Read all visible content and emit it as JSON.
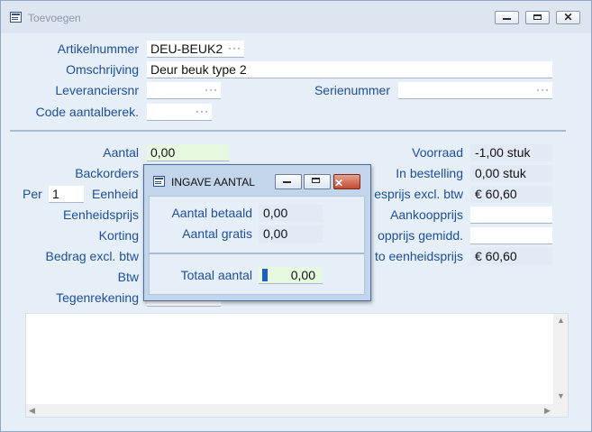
{
  "window": {
    "title": "Toevoegen"
  },
  "form": {
    "artikelnummer_label": "Artikelnummer",
    "artikelnummer_value": "DEU-BEUK2",
    "omschrijving_label": "Omschrijving",
    "omschrijving_value": "Deur beuk type 2",
    "leveranciersnr_label": "Leveranciersnr",
    "serienummer_label": "Serienummer",
    "code_aantalberek_label": "Code aantalberek.",
    "lookup_glyph": "···"
  },
  "details": {
    "aantal_label": "Aantal",
    "aantal_value": "0,00",
    "backorders_label": "Backorders",
    "per_label": "Per",
    "per_value": "1",
    "eenheid_label": "Eenheid",
    "eenheidsprijs_label": "Eenheidsprijs",
    "korting_label": "Korting",
    "bedrag_excl_btw_label": "Bedrag excl. btw",
    "btw_label": "Btw",
    "tegenrekening_label": "Tegenrekening"
  },
  "right": {
    "voorraad_label": "Voorraad",
    "voorraad_value": "-1,00 stuk",
    "in_bestelling_label": "In bestelling",
    "in_bestelling_value": "0,00 stuk",
    "verkoopprijs_label": "esprijs excl. btw",
    "verkoopprijs_value": "€ 60,60",
    "aankoopprijs_label": "Aankoopprijs",
    "aankoopprijs_gemidd_label": "opprijs gemidd.",
    "netto_eenheidsprijs_label": "to eenheidsprijs",
    "netto_eenheidsprijs_value": "€ 60,60"
  },
  "dialog": {
    "title": "INGAVE AANTAL",
    "aantal_betaald_label": "Aantal betaald",
    "aantal_betaald_value": "0,00",
    "aantal_gratis_label": "Aantal gratis",
    "aantal_gratis_value": "0,00",
    "totaal_aantal_label": "Totaal aantal",
    "totaal_aantal_value": "0,00"
  },
  "icons": {
    "minimize": "minimize-icon",
    "maximize": "maximize-icon",
    "close": "close-icon",
    "close_glyph": "✕",
    "scroll_up": "▲",
    "scroll_down": "▼",
    "scroll_left": "◀",
    "scroll_right": "▶"
  },
  "colors": {
    "label_blue": "#1c4f9c",
    "readonly_bg": "#e2ebf5",
    "input_green": "#e6f8e0",
    "close_red": "#c24a32"
  }
}
